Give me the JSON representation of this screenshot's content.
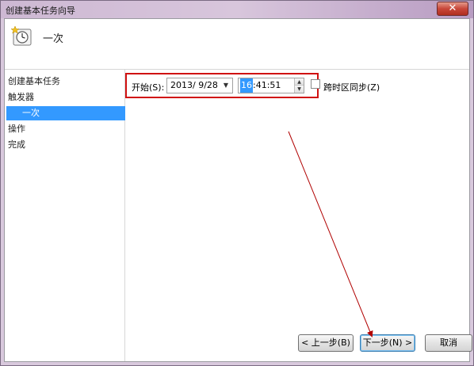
{
  "window": {
    "title": "创建基本任务向导",
    "close_glyph": "✕"
  },
  "header": {
    "title": "一次",
    "icon": "clock-wizard-icon"
  },
  "sidebar": {
    "items": [
      {
        "label": "创建基本任务"
      },
      {
        "label": "触发器"
      },
      {
        "label": "一次",
        "selected": true
      },
      {
        "label": "操作"
      },
      {
        "label": "完成"
      }
    ]
  },
  "form": {
    "start_label": "开始(S):",
    "date_value": "2013/  9/28",
    "time_hour": "16",
    "time_rest": ":41:51",
    "sync_label": "跨时区同步(Z)",
    "sync_checked": false
  },
  "buttons": {
    "back": "< 上一步(B)",
    "next": "下一步(N) >",
    "cancel": "取消"
  },
  "colors": {
    "highlight": "#d01010",
    "selection": "#3399ff",
    "arrow": "#b00000"
  }
}
